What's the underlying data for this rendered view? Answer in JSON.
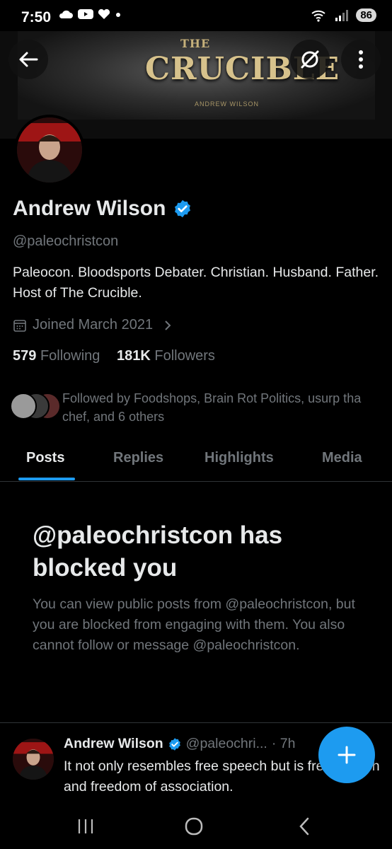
{
  "status_bar": {
    "time": "7:50",
    "battery": "86"
  },
  "banner": {
    "logo_small": "THE",
    "logo_main": "CRUCIBLE",
    "logo_sub": "ANDREW WILSON"
  },
  "profile": {
    "name": "Andrew Wilson",
    "handle": "@paleochristcon",
    "bio": "Paleocon. Bloodsports Debater. Christian. Husband. Father. Host of The Crucible.",
    "joined": "Joined March 2021",
    "following_count": "579",
    "following_label": "Following",
    "followers_count": "181K",
    "followers_label": "Followers",
    "followed_by": "Followed by Foodshops, Brain Rot Politics, usurp tha chef, and 6 others"
  },
  "tabs": [
    {
      "label": "Posts",
      "active": true
    },
    {
      "label": "Replies",
      "active": false
    },
    {
      "label": "Highlights",
      "active": false
    },
    {
      "label": "Media",
      "active": false
    }
  ],
  "blocked": {
    "title": "@paleochristcon has blocked you",
    "body": "You can view public posts from @paleochristcon, but you are blocked from engaging with them. You also cannot follow or message @paleochristcon."
  },
  "post": {
    "name": "Andrew Wilson",
    "handle": "@paleochri...",
    "time": "· 7h",
    "text": "It not only resembles free speech but is free speech and freedom of association."
  },
  "colors": {
    "accent": "#1d9bf0",
    "secondary_text": "#71767b",
    "background": "#000000"
  }
}
